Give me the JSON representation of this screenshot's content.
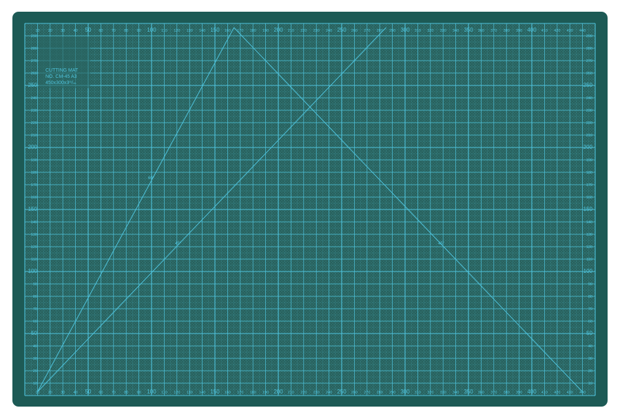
{
  "mat": {
    "brand_label": "CUTTING MAT",
    "model_label": "NO. CM-45 A3",
    "size_label": "450x300x3ᵐ/ₘ",
    "colors": {
      "border": "#1d5a55",
      "surface": "#2f6d6a",
      "grid_line": "#4fc4dd",
      "hatch": "#27605d"
    }
  },
  "ruler": {
    "top": [
      "10",
      "20",
      "30",
      "40",
      "50",
      "60",
      "70",
      "80",
      "90",
      "100",
      "110",
      "120",
      "130",
      "140",
      "150",
      "160",
      "170",
      "180",
      "190",
      "200",
      "210",
      "220",
      "230",
      "240",
      "250",
      "260",
      "270",
      "280",
      "290",
      "300",
      "310",
      "320",
      "330",
      "340",
      "350",
      "360",
      "370",
      "380",
      "390",
      "400",
      "410",
      "420",
      "430",
      "440"
    ],
    "bottom": [
      "10",
      "20",
      "30",
      "40",
      "50",
      "60",
      "70",
      "80",
      "90",
      "100",
      "110",
      "120",
      "130",
      "140",
      "150",
      "160",
      "170",
      "180",
      "190",
      "200",
      "210",
      "220",
      "230",
      "240",
      "250",
      "260",
      "270",
      "280",
      "290",
      "300",
      "310",
      "320",
      "330",
      "340",
      "350",
      "360",
      "370",
      "380",
      "390",
      "400",
      "410",
      "420",
      "430",
      "440"
    ],
    "left": [
      "290",
      "280",
      "270",
      "260",
      "250",
      "240",
      "230",
      "220",
      "210",
      "200",
      "190",
      "180",
      "170",
      "160",
      "150",
      "140",
      "130",
      "120",
      "110",
      "100",
      "90",
      "80",
      "70",
      "60",
      "50",
      "40",
      "30",
      "20",
      "10"
    ],
    "right": [
      "290",
      "280",
      "270",
      "260",
      "250",
      "240",
      "230",
      "220",
      "210",
      "200",
      "190",
      "180",
      "170",
      "160",
      "150",
      "140",
      "130",
      "120",
      "110",
      "100",
      "90",
      "80",
      "70",
      "60",
      "50",
      "40",
      "30",
      "20",
      "10"
    ]
  },
  "angles": {
    "left_upper": "60°",
    "left_lower": "45°",
    "right": "45°"
  }
}
